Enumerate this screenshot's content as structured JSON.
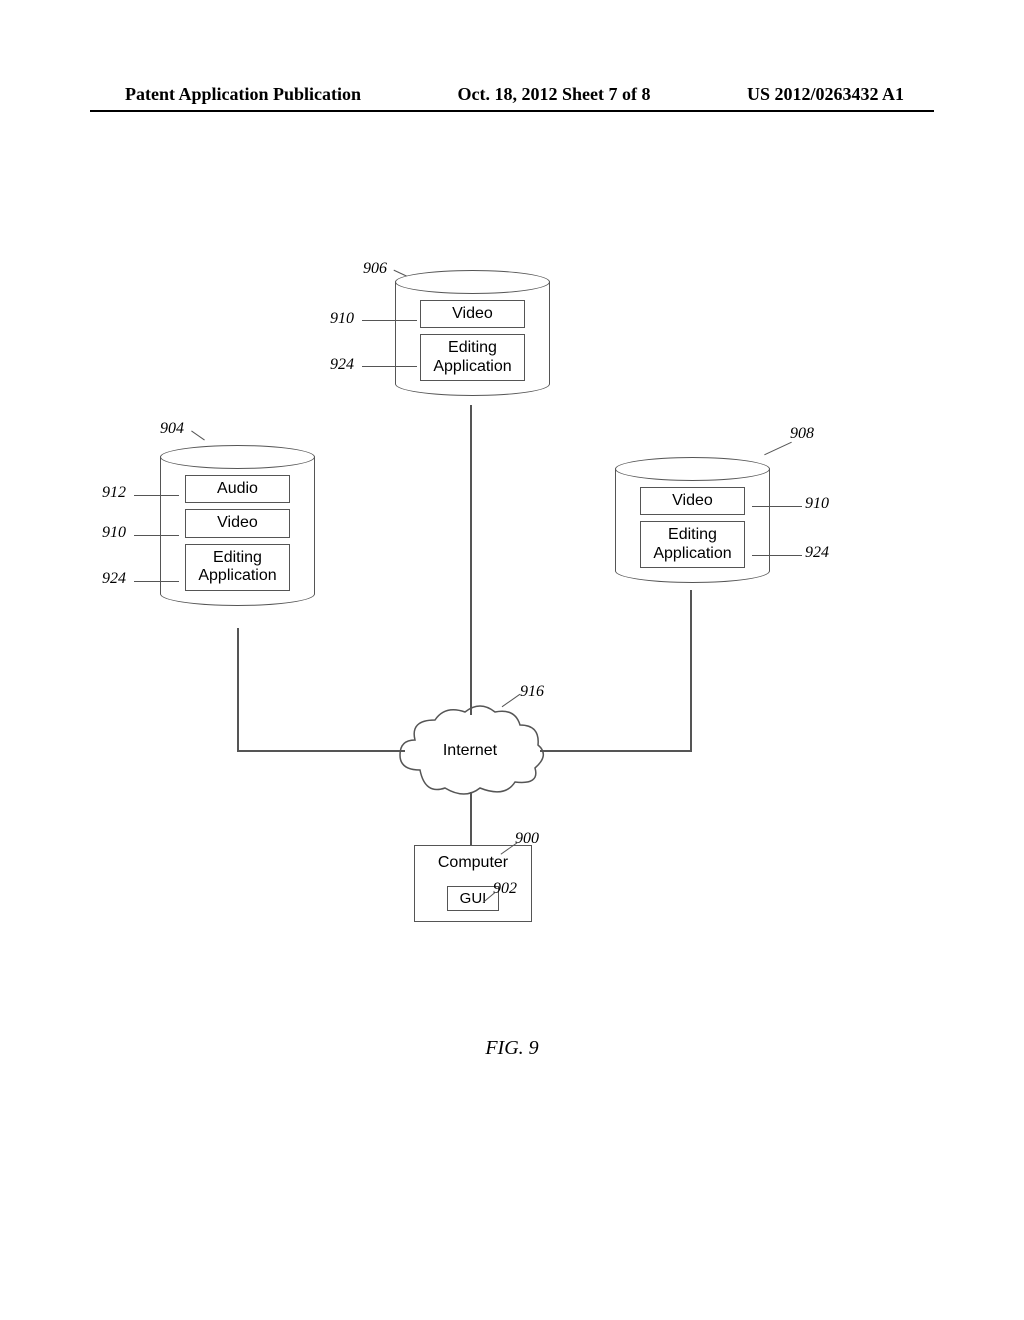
{
  "header": {
    "left": "Patent Application Publication",
    "center": "Oct. 18, 2012  Sheet 7 of 8",
    "right": "US 2012/0263432 A1"
  },
  "figure_caption": "FIG. 9",
  "refs": {
    "r900": "900",
    "r902": "902",
    "r904": "904",
    "r906": "906",
    "r908": "908",
    "r910": "910",
    "r912": "912",
    "r916": "916",
    "r924": "924"
  },
  "labels": {
    "video": "Video",
    "audio": "Audio",
    "editing_app": "Editing\nApplication",
    "internet": "Internet",
    "computer": "Computer",
    "gui": "GUI"
  },
  "chart_data": {
    "type": "diagram",
    "title": "FIG. 9",
    "nodes": [
      {
        "id": "906",
        "type": "cylinder",
        "contains": [
          {
            "ref": "910",
            "label": "Video"
          },
          {
            "ref": "924",
            "label": "Editing Application"
          }
        ]
      },
      {
        "id": "904",
        "type": "cylinder",
        "contains": [
          {
            "ref": "912",
            "label": "Audio"
          },
          {
            "ref": "910",
            "label": "Video"
          },
          {
            "ref": "924",
            "label": "Editing Application"
          }
        ]
      },
      {
        "id": "908",
        "type": "cylinder",
        "contains": [
          {
            "ref": "910",
            "label": "Video"
          },
          {
            "ref": "924",
            "label": "Editing Application"
          }
        ]
      },
      {
        "id": "916",
        "type": "cloud",
        "label": "Internet"
      },
      {
        "id": "900",
        "type": "box",
        "label": "Computer",
        "contains": [
          {
            "ref": "902",
            "label": "GUI"
          }
        ]
      }
    ],
    "edges": [
      {
        "from": "906",
        "to": "916"
      },
      {
        "from": "904",
        "to": "916"
      },
      {
        "from": "908",
        "to": "916"
      },
      {
        "from": "916",
        "to": "900"
      }
    ]
  }
}
